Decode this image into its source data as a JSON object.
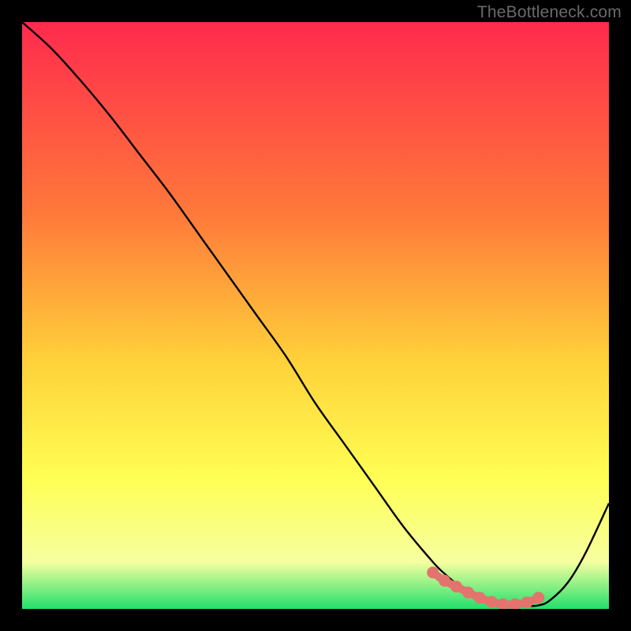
{
  "watermark": "TheBottleneck.com",
  "colors": {
    "gradient_top": "#ff2a4d",
    "gradient_mid1": "#ff7a3a",
    "gradient_mid2": "#ffd23a",
    "gradient_mid3": "#ffff55",
    "gradient_mid4": "#f6ffa0",
    "gradient_bottom": "#22e06b",
    "curve": "#000000",
    "marker": "#e2746d",
    "frame": "#000000"
  },
  "chart_data": {
    "type": "line",
    "title": "",
    "xlabel": "",
    "ylabel": "",
    "xlim": [
      0,
      100
    ],
    "ylim": [
      0,
      100
    ],
    "grid": false,
    "series": [
      {
        "name": "bottleneck-curve",
        "x": [
          0,
          5,
          10,
          15,
          20,
          25,
          30,
          35,
          40,
          45,
          50,
          55,
          60,
          65,
          70,
          72,
          75,
          78,
          80,
          82,
          85,
          88,
          90,
          93,
          96,
          100
        ],
        "y": [
          100,
          95.5,
          90,
          84,
          77.5,
          71,
          64,
          57,
          50,
          43,
          35,
          28,
          21,
          14,
          8,
          6,
          3.5,
          1.8,
          1.0,
          0.6,
          0.5,
          0.6,
          1.5,
          4.5,
          9.5,
          18
        ]
      }
    ],
    "highlight": {
      "name": "optimal-region",
      "x": [
        70,
        72,
        74,
        76,
        78,
        80,
        82,
        84,
        86,
        88
      ],
      "y": [
        6.2,
        4.8,
        3.8,
        2.8,
        1.9,
        1.2,
        0.8,
        0.8,
        1.1,
        1.9
      ]
    }
  }
}
